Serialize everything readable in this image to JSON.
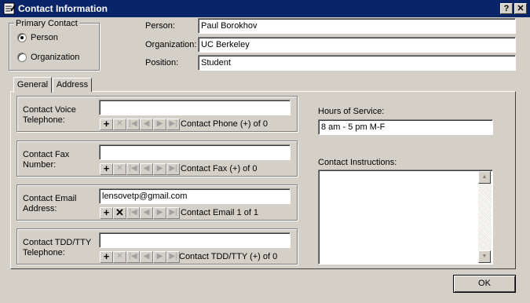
{
  "window": {
    "title": "Contact Information",
    "help_glyph": "?",
    "close_glyph": "✕"
  },
  "primary_contact": {
    "label": "Primary Contact",
    "options": [
      "Person",
      "Organization"
    ],
    "selected": "Person"
  },
  "fields": {
    "person": {
      "label": "Person:",
      "value": "Paul Borokhov"
    },
    "organization": {
      "label": "Organization:",
      "value": "UC Berkeley"
    },
    "position": {
      "label": "Position:",
      "value": "Student"
    }
  },
  "tabs": [
    "General",
    "Address"
  ],
  "active_tab": "General",
  "contacts": [
    {
      "label_line1": "Contact Voice",
      "label_line2": "Telephone:",
      "value": "",
      "status": "Contact Phone (+) of 0"
    },
    {
      "label_line1": "Contact Fax",
      "label_line2": "Number:",
      "value": "",
      "status": "Contact Fax (+) of 0"
    },
    {
      "label_line1": "Contact Email",
      "label_line2": "Address:",
      "value": "lensovetp@gmail.com",
      "status": "Contact Email 1 of 1"
    },
    {
      "label_line1": "Contact TDD/TTY",
      "label_line2": "Telephone:",
      "value": "",
      "status": "Contact TDD/TTY (+) of 0"
    }
  ],
  "nav_glyphs": {
    "add": "+",
    "delete": "✕",
    "first": "|◀",
    "prev": "◀",
    "next": "▶",
    "last": "▶|"
  },
  "hours": {
    "label": "Hours of Service:",
    "value": "8 am - 5 pm M-F"
  },
  "instructions": {
    "label": "Contact Instructions:",
    "value": ""
  },
  "ok_label": "OK"
}
